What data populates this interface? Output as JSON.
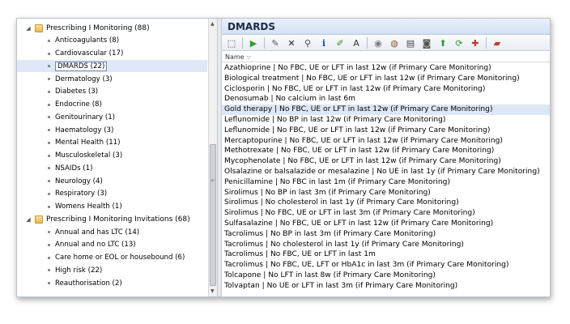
{
  "tree": {
    "groups": [
      {
        "label": "Prescribing I Monitoring (88)",
        "expanded": true,
        "items": [
          {
            "label": "Anticoagulants (8)"
          },
          {
            "label": "Cardiovascular (17)"
          },
          {
            "label": "DMARDS (22)",
            "selected": true
          },
          {
            "label": "Dermatology (3)"
          },
          {
            "label": "Diabetes (3)"
          },
          {
            "label": "Endocrine (8)"
          },
          {
            "label": "Genitourinary (1)"
          },
          {
            "label": "Haematology (3)"
          },
          {
            "label": "Mental Health (11)"
          },
          {
            "label": "Musculoskeletal (3)"
          },
          {
            "label": "NSAIDs (1)"
          },
          {
            "label": "Neurology (4)"
          },
          {
            "label": "Respiratory (3)"
          },
          {
            "label": "Womens Health (1)"
          }
        ]
      },
      {
        "label": "Prescribing I Monitoring Invitations (68)",
        "expanded": true,
        "items": [
          {
            "label": "Annual and has LTC (14)"
          },
          {
            "label": "Annual and no LTC (13)"
          },
          {
            "label": "Care home or EOL or housebound (6)"
          },
          {
            "label": "High risk (22)"
          },
          {
            "label": "Reauthorisation (2)"
          }
        ]
      }
    ],
    "expander_glyph": "◢",
    "folder_icon": "folder-icon"
  },
  "panel": {
    "title": "DMARDS",
    "column_header": "Name",
    "sort_glyph": "▽",
    "toolbar_icons": [
      {
        "name": "select-all-icon",
        "glyph": "⬚",
        "color": "#333333"
      },
      {
        "sep": true
      },
      {
        "name": "run-icon",
        "glyph": "▶",
        "color": "#2e9e2e"
      },
      {
        "sep": true
      },
      {
        "name": "edit-icon",
        "glyph": "✎",
        "color": "#555555"
      },
      {
        "name": "delete-icon",
        "glyph": "✕",
        "color": "#222222"
      },
      {
        "name": "find-icon",
        "glyph": "⚲",
        "color": "#444444"
      },
      {
        "name": "info-icon",
        "glyph": "i",
        "color": "#1f4fbf"
      },
      {
        "name": "pen-icon",
        "glyph": "✐",
        "color": "#3a8a2a"
      },
      {
        "name": "font-icon",
        "glyph": "A",
        "color": "#333333"
      },
      {
        "sep": true
      },
      {
        "name": "database-icon",
        "glyph": "◉",
        "color": "#7a7a7a"
      },
      {
        "name": "database-export-icon",
        "glyph": "◍",
        "color": "#8a5a2a"
      },
      {
        "name": "report-icon",
        "glyph": "▤",
        "color": "#444444"
      },
      {
        "name": "camera-icon",
        "glyph": "◙",
        "color": "#555555"
      },
      {
        "name": "move-up-icon",
        "glyph": "⬆",
        "color": "#2e9e2e"
      },
      {
        "name": "refresh-icon",
        "glyph": "⟳",
        "color": "#2e9e2e"
      },
      {
        "name": "merge-icon",
        "glyph": "✚",
        "color": "#c0392b"
      },
      {
        "sep": true
      },
      {
        "name": "book-icon",
        "glyph": "▰",
        "color": "#c0392b"
      }
    ],
    "rows": [
      {
        "text": "Azathioprine | No FBC, UE or LFT in last 12w (if Primary Care Monitoring)"
      },
      {
        "text": "Biological treatment | No FBC, UE or LFT in last 12w (if Primary Care Monitoring)"
      },
      {
        "text": "Ciclosporin | No FBC, UE or LFT in last 12w (if Primary Care Monitoring)"
      },
      {
        "text": "Denosumab | No calcium in last 6m"
      },
      {
        "text": "Gold therapy | No FBC, UE or LFT in last 12w (if Primary Care Monitoring)",
        "highlighted": true
      },
      {
        "text": "Leflunomide | No BP in last 12w (if Primary Care Monitoring)"
      },
      {
        "text": "Leflunomide | No FBC, UE or LFT in last 12w (if Primary Care Monitoring)"
      },
      {
        "text": "Mercaptopurine | No FBC, UE or LFT in last 12w (if Primary Care Monitoring)"
      },
      {
        "text": "Methotrexate | No FBC, UE or LFT in last 12w (if Primary Care Monitoring)"
      },
      {
        "text": "Mycophenolate | No FBC, UE or LFT in last 12w (if Primary Care Monitoring)"
      },
      {
        "text": "Olsalazine or balsalazide or mesalazine | No UE in last 1y (if Primary Care Monitoring)"
      },
      {
        "text": "Penicillamine | No FBC in last 1m (if Primary Care Monitoring)"
      },
      {
        "text": "Sirolimus | No BP in last 3m (if Primary Care Monitoring)"
      },
      {
        "text": "Sirolimus | No cholesterol in last 1y (if Primary Care Monitoring)"
      },
      {
        "text": "Sirolimus | No FBC, UE or LFT in last 3m (if Primary Care Monitoring)"
      },
      {
        "text": "Sulfasalazine | No FBC, UE or LFT in last 12w (if Primary Care Monitoring)"
      },
      {
        "text": "Tacrolimus | No BP in last 3m (if Primary Care Monitoring)"
      },
      {
        "text": "Tacrolimus | No cholesterol in last 1y (if Primary Care Monitoring)"
      },
      {
        "text": "Tacrolimus | No FBC, UE or LFT in last 1m"
      },
      {
        "text": "Tacrolimus | No FBC, UE, LFT or HbA1c in last 3m (if Primary Care Monitoring)"
      },
      {
        "text": "Tolcapone | No LFT in last 8w (if Primary Care Monitoring)"
      },
      {
        "text": "Tolvaptan | No UE or LFT in last 3m (if Primary Care Monitoring)"
      }
    ]
  },
  "scrollbar": {
    "up_glyph": "▲",
    "down_glyph": "▼",
    "grip_glyph": "≡"
  }
}
